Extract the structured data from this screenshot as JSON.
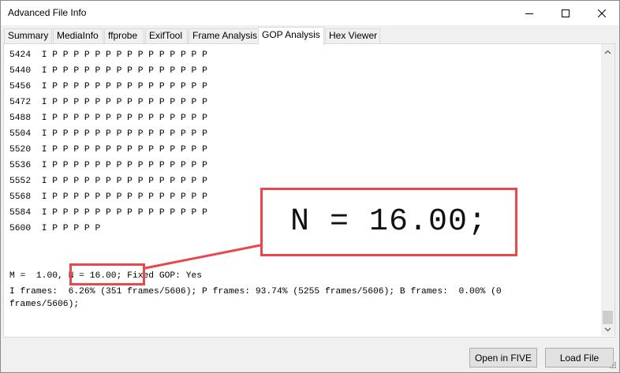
{
  "window": {
    "title": "Advanced File Info"
  },
  "tabs": [
    {
      "label": "Summary"
    },
    {
      "label": "MediaInfo"
    },
    {
      "label": "ffprobe"
    },
    {
      "label": "ExifTool"
    },
    {
      "label": "Frame Analysis"
    },
    {
      "label": "GOP Analysis",
      "active": true
    },
    {
      "label": "Hex Viewer"
    }
  ],
  "gop_rows": [
    {
      "index": "5424",
      "frames": "I P P P P P P P P P P P P P P P"
    },
    {
      "index": "5440",
      "frames": "I P P P P P P P P P P P P P P P"
    },
    {
      "index": "5456",
      "frames": "I P P P P P P P P P P P P P P P"
    },
    {
      "index": "5472",
      "frames": "I P P P P P P P P P P P P P P P"
    },
    {
      "index": "5488",
      "frames": "I P P P P P P P P P P P P P P P"
    },
    {
      "index": "5504",
      "frames": "I P P P P P P P P P P P P P P P"
    },
    {
      "index": "5520",
      "frames": "I P P P P P P P P P P P P P P P"
    },
    {
      "index": "5536",
      "frames": "I P P P P P P P P P P P P P P P"
    },
    {
      "index": "5552",
      "frames": "I P P P P P P P P P P P P P P P"
    },
    {
      "index": "5568",
      "frames": "I P P P P P P P P P P P P P P P"
    },
    {
      "index": "5584",
      "frames": "I P P P P P P P P P P P P P P P"
    },
    {
      "index": "5600",
      "frames": "I P P P P P"
    }
  ],
  "summary": {
    "m_part": "M =  1.00, ",
    "n_part": "N = 16.00;",
    "gop_part": " Fixed GOP: Yes",
    "line2": "I frames:  6.26% (351 frames/5606); P frames: 93.74% (5255 frames/5606); B frames:  0.00% (0",
    "line3": "frames/5606);"
  },
  "callout": {
    "zoom_text": "N = 16.00;"
  },
  "buttons": {
    "open_five": "Open in FIVE",
    "load_file": "Load File"
  },
  "colors": {
    "highlight": "#e8474c"
  }
}
